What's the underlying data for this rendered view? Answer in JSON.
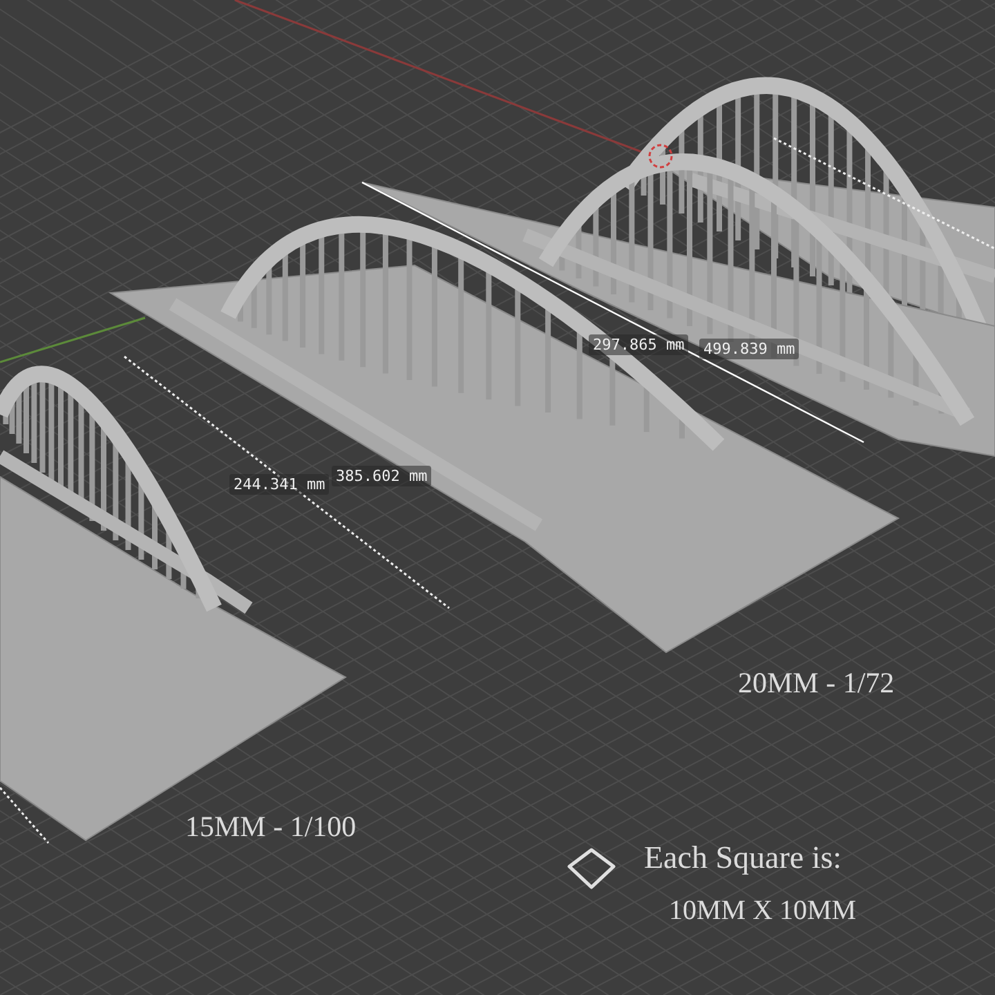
{
  "viewport": {
    "measurements": [
      {
        "value": "297.865 mm"
      },
      {
        "value": "499.839 mm"
      },
      {
        "value": "244.341 mm"
      },
      {
        "value": "385.602 mm"
      }
    ],
    "scale_labels": [
      {
        "text": "20MM - 1/72"
      },
      {
        "text": "15MM - 1/100"
      }
    ],
    "legend": {
      "title": "Each Square is:",
      "size": "10MM X 10MM"
    }
  }
}
